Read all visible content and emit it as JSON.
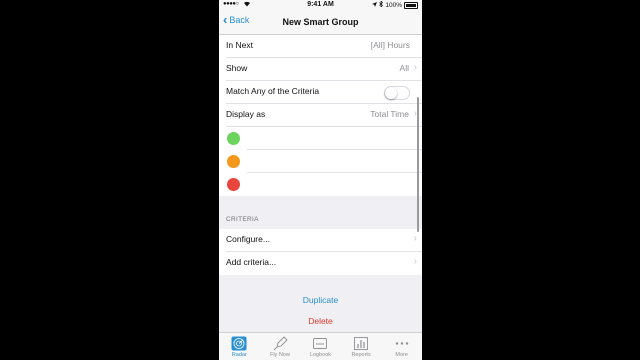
{
  "status_bar": {
    "signal": "●●●●○",
    "time": "9:41 AM",
    "battery_text": "100%"
  },
  "navbar": {
    "back_label": "Back",
    "title": "New Smart Group"
  },
  "settings": {
    "in_next": {
      "label": "In Next",
      "value": "[All] Hours"
    },
    "show": {
      "label": "Show",
      "value": "All"
    },
    "match_any": {
      "label": "Match Any of the Criteria",
      "on": false
    },
    "display_as": {
      "label": "Display as",
      "value": "Total Time"
    }
  },
  "colors": {
    "green": "#6cd45c",
    "orange": "#f5971a",
    "red": "#e8463c",
    "accent": "#2a8fd1",
    "destructive": "#e03a2e"
  },
  "criteria": {
    "header": "CRITERIA",
    "configure_label": "Configure...",
    "add_label": "Add criteria..."
  },
  "actions": {
    "duplicate_label": "Duplicate",
    "delete_label": "Delete"
  },
  "tabbar": {
    "tabs": [
      {
        "label": "Radar",
        "icon": "radar-icon",
        "active": true
      },
      {
        "label": "Fly Now",
        "icon": "rocket-icon",
        "active": false
      },
      {
        "label": "Logbook",
        "icon": "logbook-icon",
        "active": false
      },
      {
        "label": "Reports",
        "icon": "reports-icon",
        "active": false
      },
      {
        "label": "More",
        "icon": "more-icon",
        "active": false
      }
    ]
  }
}
